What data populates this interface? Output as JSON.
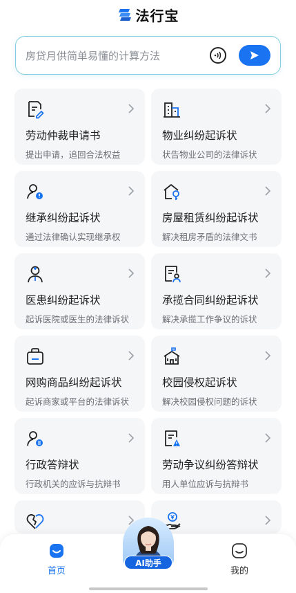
{
  "app": {
    "brand_name": "法行宝"
  },
  "search": {
    "placeholder": "房贷月供简单易懂的计算方法",
    "voice_icon": "voice-icon",
    "send_icon": "send-arrow-icon"
  },
  "cards": [
    {
      "icon": "document-edit-icon",
      "title": "劳动仲裁申请书",
      "desc": "提出申请，追回合法权益"
    },
    {
      "icon": "building-icon",
      "title": "物业纠纷起诉状",
      "desc": "状告物业公司的法律诉状"
    },
    {
      "icon": "person-alert-icon",
      "title": "继承纠纷起诉状",
      "desc": "通过法律确认实现继承权"
    },
    {
      "icon": "house-key-icon",
      "title": "房屋租赁纠纷起诉状",
      "desc": "解决租房矛盾的法律文书"
    },
    {
      "icon": "doctor-icon",
      "title": "医患纠纷起诉状",
      "desc": "起诉医院或医生的法律诉状"
    },
    {
      "icon": "contract-person-icon",
      "title": "承揽合同纠纷起诉状",
      "desc": "解决承揽工作争议的诉状"
    },
    {
      "icon": "shopping-bag-icon",
      "title": "网购商品纠纷起诉状",
      "desc": "起诉商家或平台的法律诉状"
    },
    {
      "icon": "school-icon",
      "title": "校园侵权起诉状",
      "desc": "解决校园侵权问题的诉状"
    },
    {
      "icon": "person-badge-icon",
      "title": "行政答辩状",
      "desc": "行政机关的应诉与抗辩书"
    },
    {
      "icon": "document-warning-icon",
      "title": "劳动争议纠纷答辩状",
      "desc": "用人单位应诉与抗辩书"
    },
    {
      "icon": "broken-heart-icon",
      "title": "",
      "desc": ""
    },
    {
      "icon": "money-hand-icon",
      "title": "",
      "desc": ""
    }
  ],
  "bottom_nav": {
    "home_label": "首页",
    "ai_label": "AI助手",
    "mine_label": "我的"
  },
  "colors": {
    "accent": "#1a73f0",
    "card_bg": "#f5f6f8",
    "search_border": "#7fd0dc"
  }
}
